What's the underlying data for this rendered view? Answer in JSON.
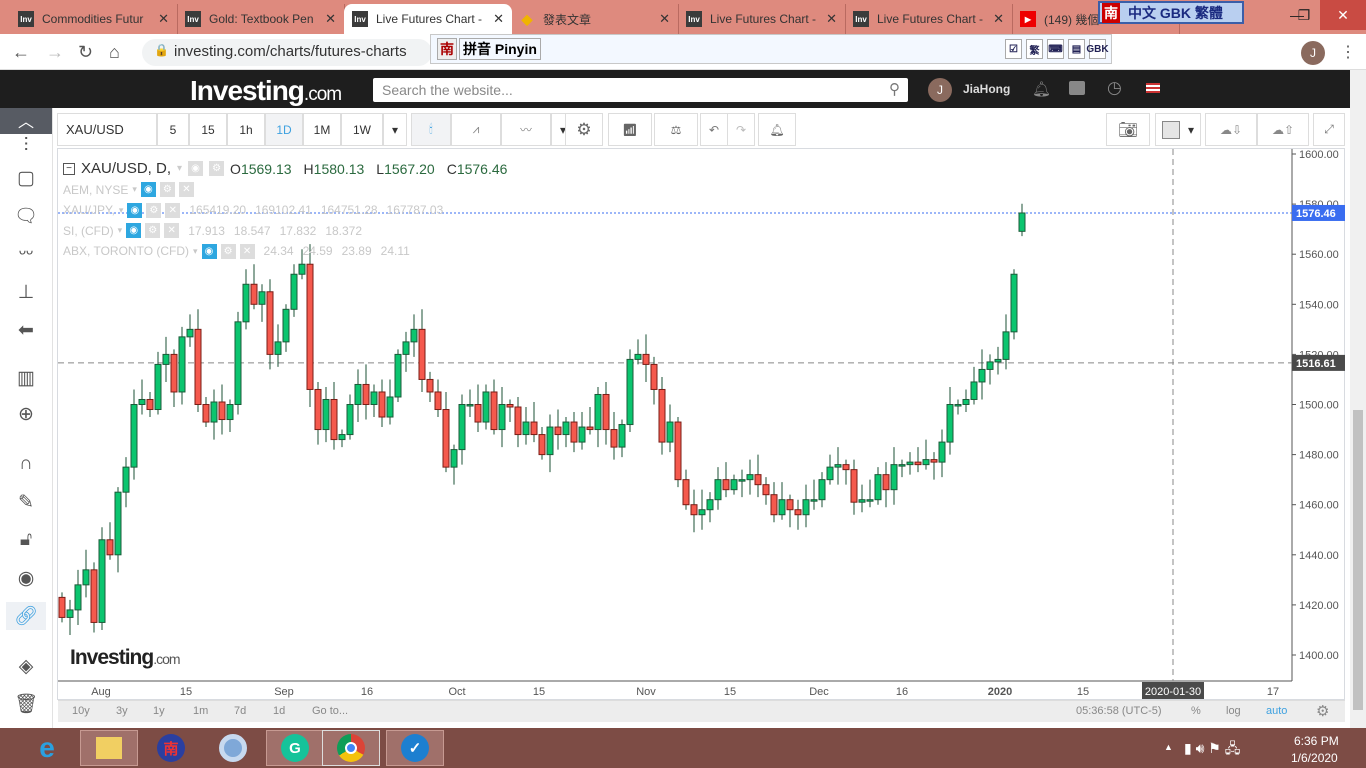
{
  "browser": {
    "tabs": [
      {
        "title": "Commodities Futur",
        "icon": "investing-favicon"
      },
      {
        "title": "Gold: Textbook Pen",
        "icon": "investing-favicon"
      },
      {
        "title": "Live Futures Chart -",
        "icon": "investing-favicon",
        "active": true
      },
      {
        "title": "發表文章",
        "icon": "diamond-favicon"
      },
      {
        "title": "Live Futures Chart -",
        "icon": "investing-favicon"
      },
      {
        "title": "Live Futures Chart -",
        "icon": "investing-favicon"
      },
      {
        "title": "(149) 幾個",
        "icon": "youtube-favicon"
      }
    ],
    "fav_text": "Inv",
    "close_glyph": "✕",
    "url": "investing.com/charts/futures-charts",
    "profile_initial": "J"
  },
  "ime": {
    "logo": "南",
    "status": "中文  GBK  繁體",
    "pinyin_label": "拼音 Pinyin",
    "buttons": [
      "☑",
      "繁",
      "⌨",
      "▤",
      "GBK"
    ]
  },
  "site": {
    "logo": "Investing",
    "logo_suffix": ".com",
    "search_placeholder": "Search the website...",
    "user": "JiaHong",
    "user_initial": "J"
  },
  "toolbar": {
    "symbol": "XAU/USD",
    "intervals": [
      "5",
      "15",
      "1h",
      "1D",
      "1M",
      "1W"
    ],
    "selected_interval": "1D"
  },
  "legend": {
    "main": {
      "symbol": "XAU/USD, D,",
      "o_label": "O",
      "o": "1569.13",
      "h_label": "H",
      "h": "1580.13",
      "l_label": "L",
      "l": "1567.20",
      "c_label": "C",
      "c": "1576.46"
    },
    "overlays": [
      {
        "name": "AEM, NYSE",
        "values": []
      },
      {
        "name": "XAU/JPY,",
        "values": [
          "165419.20",
          "169102.41",
          "164751.28",
          "167787.03"
        ]
      },
      {
        "name": "SI, (CFD)",
        "values": [
          "17.913",
          "18.547",
          "17.832",
          "18.372"
        ]
      },
      {
        "name": "ABX, TORONTO (CFD)",
        "values": [
          "24.34",
          "24.59",
          "23.89",
          "24.11"
        ]
      }
    ]
  },
  "watermark": {
    "logo": "Investing",
    "suffix": ".com"
  },
  "chart_data": {
    "type": "candlestick",
    "title": "XAU/USD, D",
    "ylim": [
      1390,
      1602
    ],
    "y_ticks": [
      "1400.00",
      "1420.00",
      "1440.00",
      "1460.00",
      "1480.00",
      "1500.00",
      "1520.00",
      "1540.00",
      "1560.00",
      "1580.00",
      "1600.00"
    ],
    "x_ticks": [
      "Aug",
      "15",
      "Sep",
      "16",
      "Oct",
      "15",
      "Nov",
      "15",
      "Dec",
      "16",
      "2020",
      "15",
      "17"
    ],
    "crosshair_date": "2020-01-30",
    "last_price": "1576.46",
    "crosshair_price": "1516.61",
    "last_candle": {
      "o": 1569.13,
      "h": 1580.13,
      "l": 1567.2,
      "c": 1576.46
    },
    "closes": [
      1415,
      1418,
      1428,
      1434,
      1413,
      1446,
      1440,
      1465,
      1475,
      1500,
      1502,
      1498,
      1516,
      1520,
      1505,
      1527,
      1530,
      1500,
      1493,
      1501,
      1494,
      1500,
      1533,
      1548,
      1540,
      1545,
      1520,
      1525,
      1538,
      1552,
      1556,
      1506,
      1490,
      1502,
      1486,
      1488,
      1500,
      1508,
      1500,
      1505,
      1495,
      1503,
      1520,
      1525,
      1530,
      1510,
      1505,
      1498,
      1475,
      1482,
      1500,
      1500,
      1493,
      1505,
      1490,
      1500,
      1499,
      1488,
      1493,
      1488,
      1480,
      1491,
      1488,
      1493,
      1485,
      1491,
      1490,
      1504,
      1490,
      1483,
      1492,
      1518,
      1520,
      1516,
      1506,
      1485,
      1493,
      1470,
      1460,
      1456,
      1458,
      1462,
      1470,
      1466,
      1470,
      1470,
      1472,
      1468,
      1464,
      1456,
      1462,
      1458,
      1456,
      1462,
      1462,
      1470,
      1475,
      1476,
      1474,
      1461,
      1462,
      1462,
      1472,
      1466,
      1476,
      1476,
      1477,
      1476,
      1478,
      1477,
      1485,
      1500,
      1500,
      1502,
      1509,
      1514,
      1517,
      1518,
      1529,
      1552,
      1576.46
    ],
    "colors": {
      "up": "#0bc56f",
      "down": "#f5594d",
      "up_border": "#1b5a38",
      "down_border": "#7a1d16",
      "last_line": "#3a6df0"
    }
  },
  "bottom": {
    "ranges": [
      "10y",
      "3y",
      "1y",
      "1m",
      "7d",
      "1d",
      "Go to..."
    ],
    "clock": "05:36:58 (UTC-5)",
    "pct": "%",
    "log": "log",
    "auto": "auto"
  },
  "taskbar": {
    "time": "6:36 PM",
    "date": "1/6/2020"
  }
}
